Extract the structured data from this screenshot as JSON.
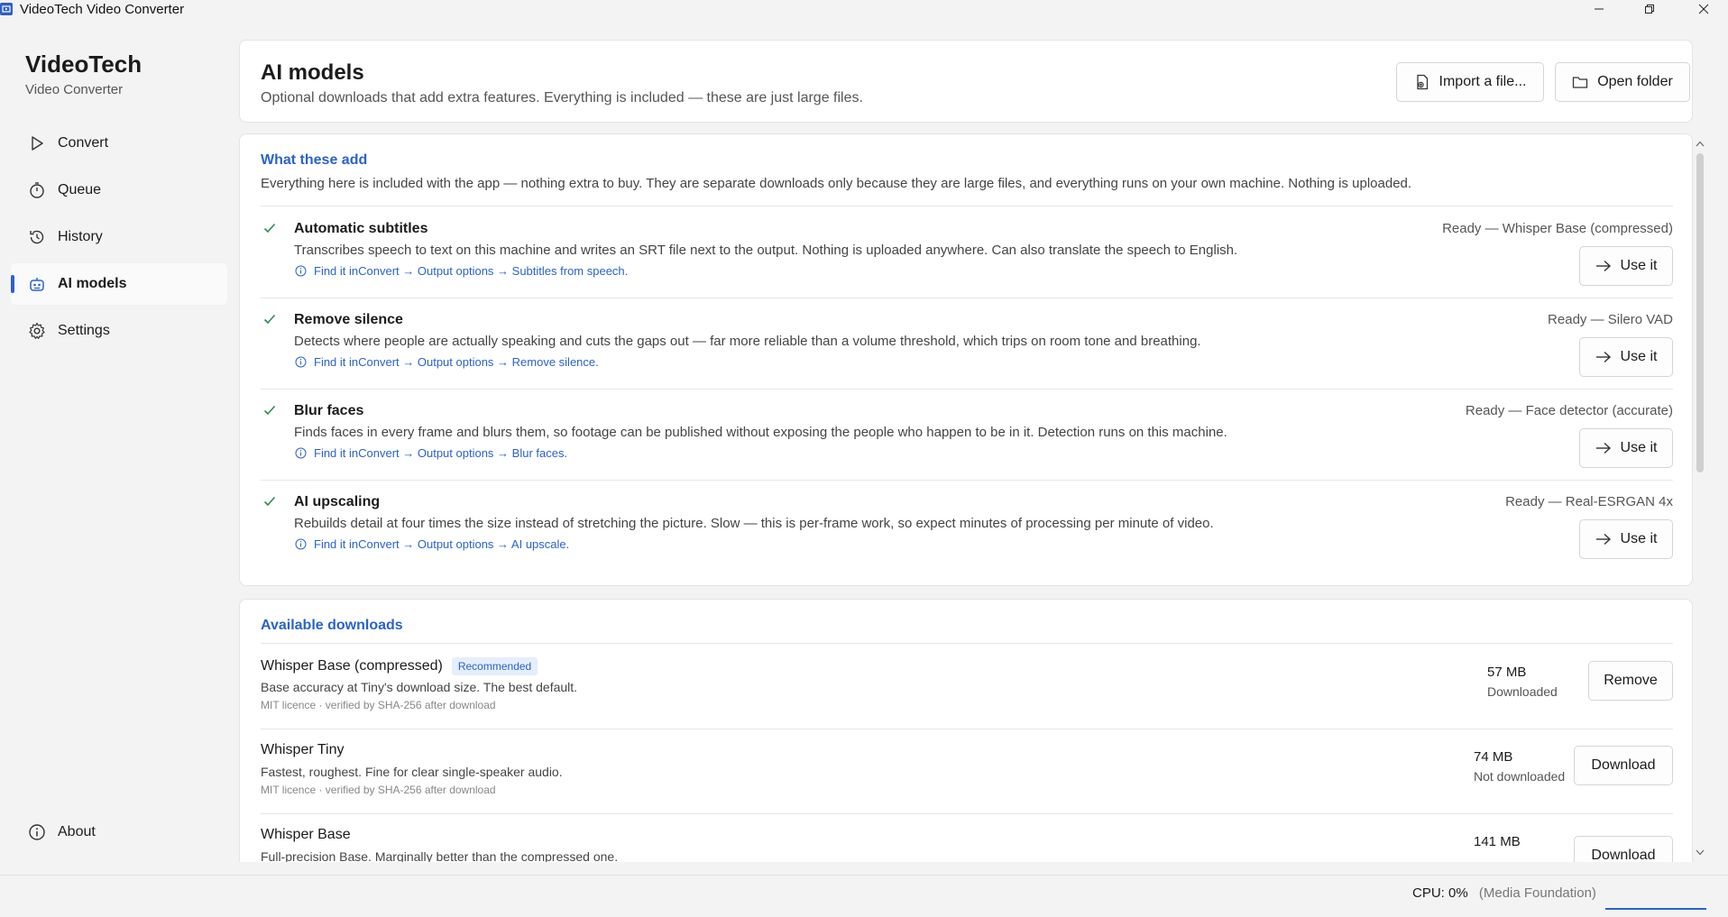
{
  "window": {
    "title": "VideoTech Video Converter"
  },
  "brand": {
    "name": "VideoTech",
    "subtitle": "Video Converter"
  },
  "sidebar": {
    "items": [
      {
        "label": "Convert",
        "icon": "play-icon",
        "active": false
      },
      {
        "label": "Queue",
        "icon": "stopwatch-icon",
        "active": false
      },
      {
        "label": "History",
        "icon": "history-icon",
        "active": false
      },
      {
        "label": "AI models",
        "icon": "robot-icon",
        "active": true
      },
      {
        "label": "Settings",
        "icon": "gear-icon",
        "active": false
      }
    ],
    "about": "About"
  },
  "header": {
    "title": "AI models",
    "description": "Optional downloads that add extra features. Everything is included — these are just large files.",
    "import_label": "Import a file...",
    "open_folder_label": "Open folder"
  },
  "features": {
    "title": "What these add",
    "description": "Everything here is included with the app — nothing extra to buy. They are separate downloads only because they are large files, and everything runs on your own machine. Nothing is uploaded.",
    "items": [
      {
        "title": "Automatic subtitles",
        "description": "Transcribes speech to text on this machine and writes an SRT file next to the output. Nothing is uploaded anywhere. Can also translate the speech to English.",
        "link": "Find it inConvert → Output options → Subtitles from speech.",
        "status": "Ready — Whisper Base (compressed)",
        "button": "Use it"
      },
      {
        "title": "Remove silence",
        "description": "Detects where people are actually speaking and cuts the gaps out — far more reliable than a volume threshold, which trips on room tone and breathing.",
        "link": "Find it inConvert → Output options → Remove silence.",
        "status": "Ready — Silero VAD",
        "button": "Use it"
      },
      {
        "title": "Blur faces",
        "description": "Finds faces in every frame and blurs them, so footage can be published without exposing the people who happen to be in it. Detection runs on this machine.",
        "link": "Find it inConvert → Output options → Blur faces.",
        "status": "Ready — Face detector (accurate)",
        "button": "Use it"
      },
      {
        "title": "AI upscaling",
        "description": "Rebuilds detail at four times the size instead of stretching the picture. Slow — this is per-frame work, so expect minutes of processing per minute of video.",
        "link": "Find it inConvert → Output options → AI upscale.",
        "status": "Ready — Real-ESRGAN 4x",
        "button": "Use it"
      }
    ]
  },
  "downloads": {
    "title": "Available downloads",
    "items": [
      {
        "name": "Whisper Base (compressed)",
        "badge": "Recommended",
        "description": "Base accuracy at Tiny's download size. The best default.",
        "licence": "MIT licence · verified by SHA-256 after download",
        "size": "57 MB",
        "state": "Downloaded",
        "button": "Remove"
      },
      {
        "name": "Whisper Tiny",
        "badge": "",
        "description": "Fastest, roughest. Fine for clear single-speaker audio.",
        "licence": "MIT licence · verified by SHA-256 after download",
        "size": "74 MB",
        "state": "Not downloaded",
        "button": "Download"
      },
      {
        "name": "Whisper Base",
        "badge": "",
        "description": "Full-precision Base. Marginally better than the compressed one.",
        "licence": "",
        "size": "141 MB",
        "state": "",
        "button": "Download"
      }
    ]
  },
  "status": {
    "cpu": "CPU: 0%",
    "backend": "(Media Foundation)"
  },
  "colors": {
    "accent": "#2a63c9",
    "background": "#f3f3f3",
    "card": "#ffffff",
    "check": "#2e8b57"
  }
}
